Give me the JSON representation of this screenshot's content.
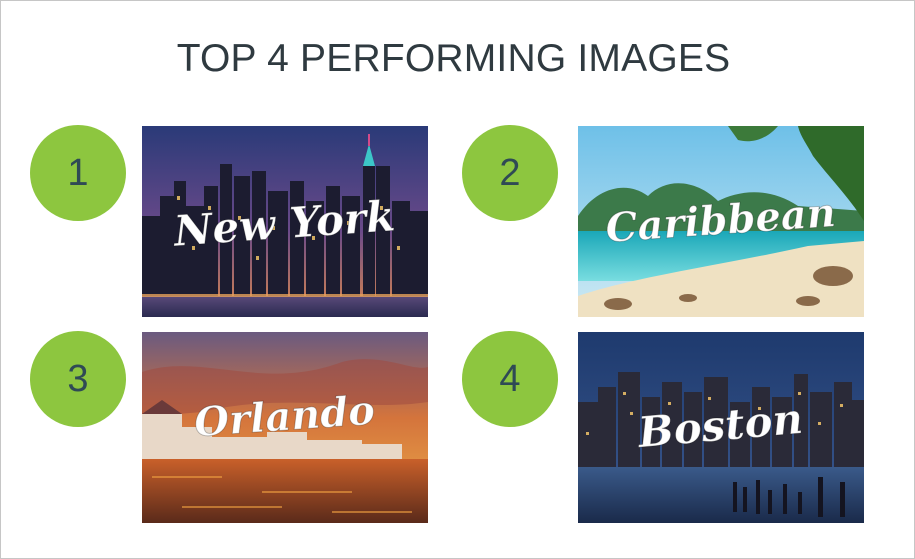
{
  "title": "TOP 4 PERFORMING IMAGES",
  "colors": {
    "badge": "#8dc63f",
    "badge_text": "#2f4a55",
    "title_text": "#2f3a40"
  },
  "images": [
    {
      "rank": "1",
      "label": "New York"
    },
    {
      "rank": "2",
      "label": "Caribbean"
    },
    {
      "rank": "3",
      "label": "Orlando"
    },
    {
      "rank": "4",
      "label": "Boston"
    }
  ]
}
